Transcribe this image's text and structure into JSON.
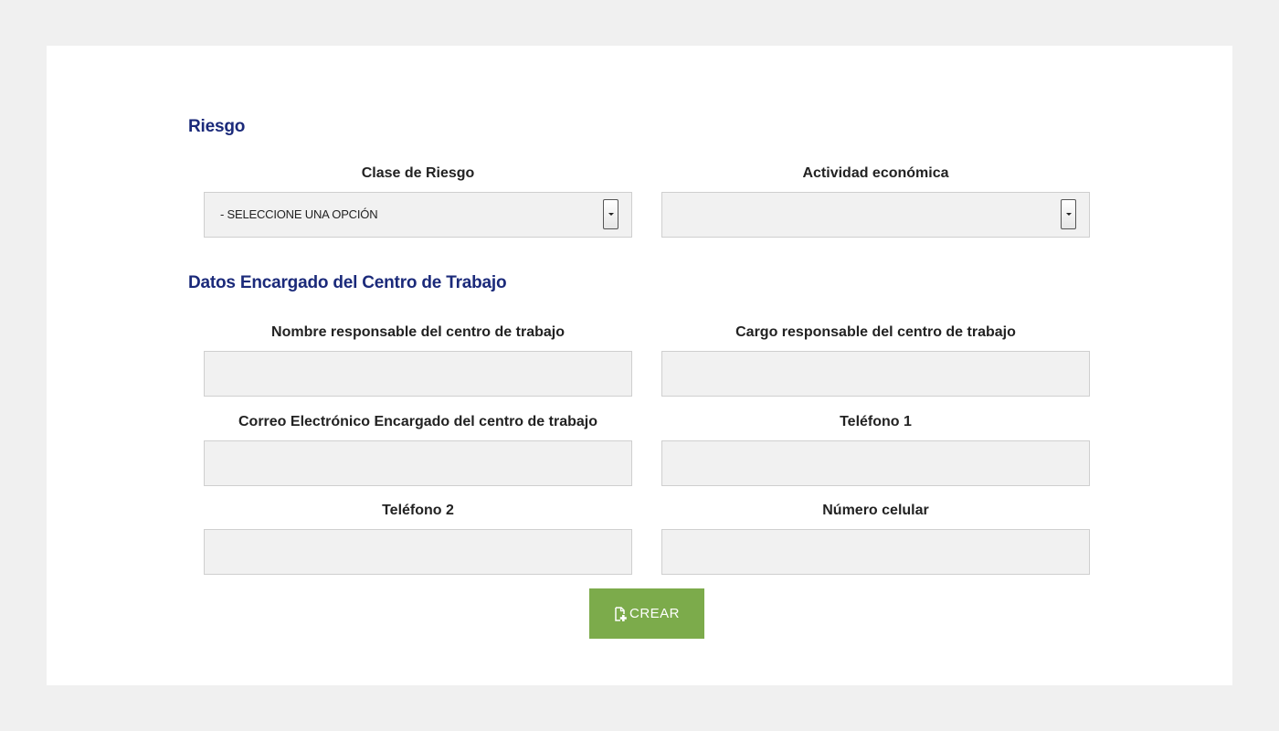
{
  "sections": {
    "riesgo": {
      "title": "Riesgo",
      "clase_riesgo": {
        "label": "Clase de Riesgo",
        "selected": "- SELECCIONE UNA OPCIÓN"
      },
      "actividad_economica": {
        "label": "Actividad económica",
        "selected": ""
      }
    },
    "encargado": {
      "title": "Datos Encargado del Centro de Trabajo",
      "nombre": {
        "label": "Nombre responsable del centro de trabajo",
        "value": ""
      },
      "cargo": {
        "label": "Cargo responsable del centro de trabajo",
        "value": ""
      },
      "correo": {
        "label": "Correo Electrónico Encargado del centro de trabajo",
        "value": ""
      },
      "telefono1": {
        "label": "Teléfono 1",
        "value": ""
      },
      "telefono2": {
        "label": "Teléfono 2",
        "value": ""
      },
      "celular": {
        "label": "Número celular",
        "value": ""
      }
    }
  },
  "actions": {
    "crear_label": "CREAR",
    "crear_icon": "file-plus-icon"
  },
  "colors": {
    "section_title": "#1b2a7a",
    "button": "#7cab4b",
    "field_bg": "#f1f1f1"
  }
}
